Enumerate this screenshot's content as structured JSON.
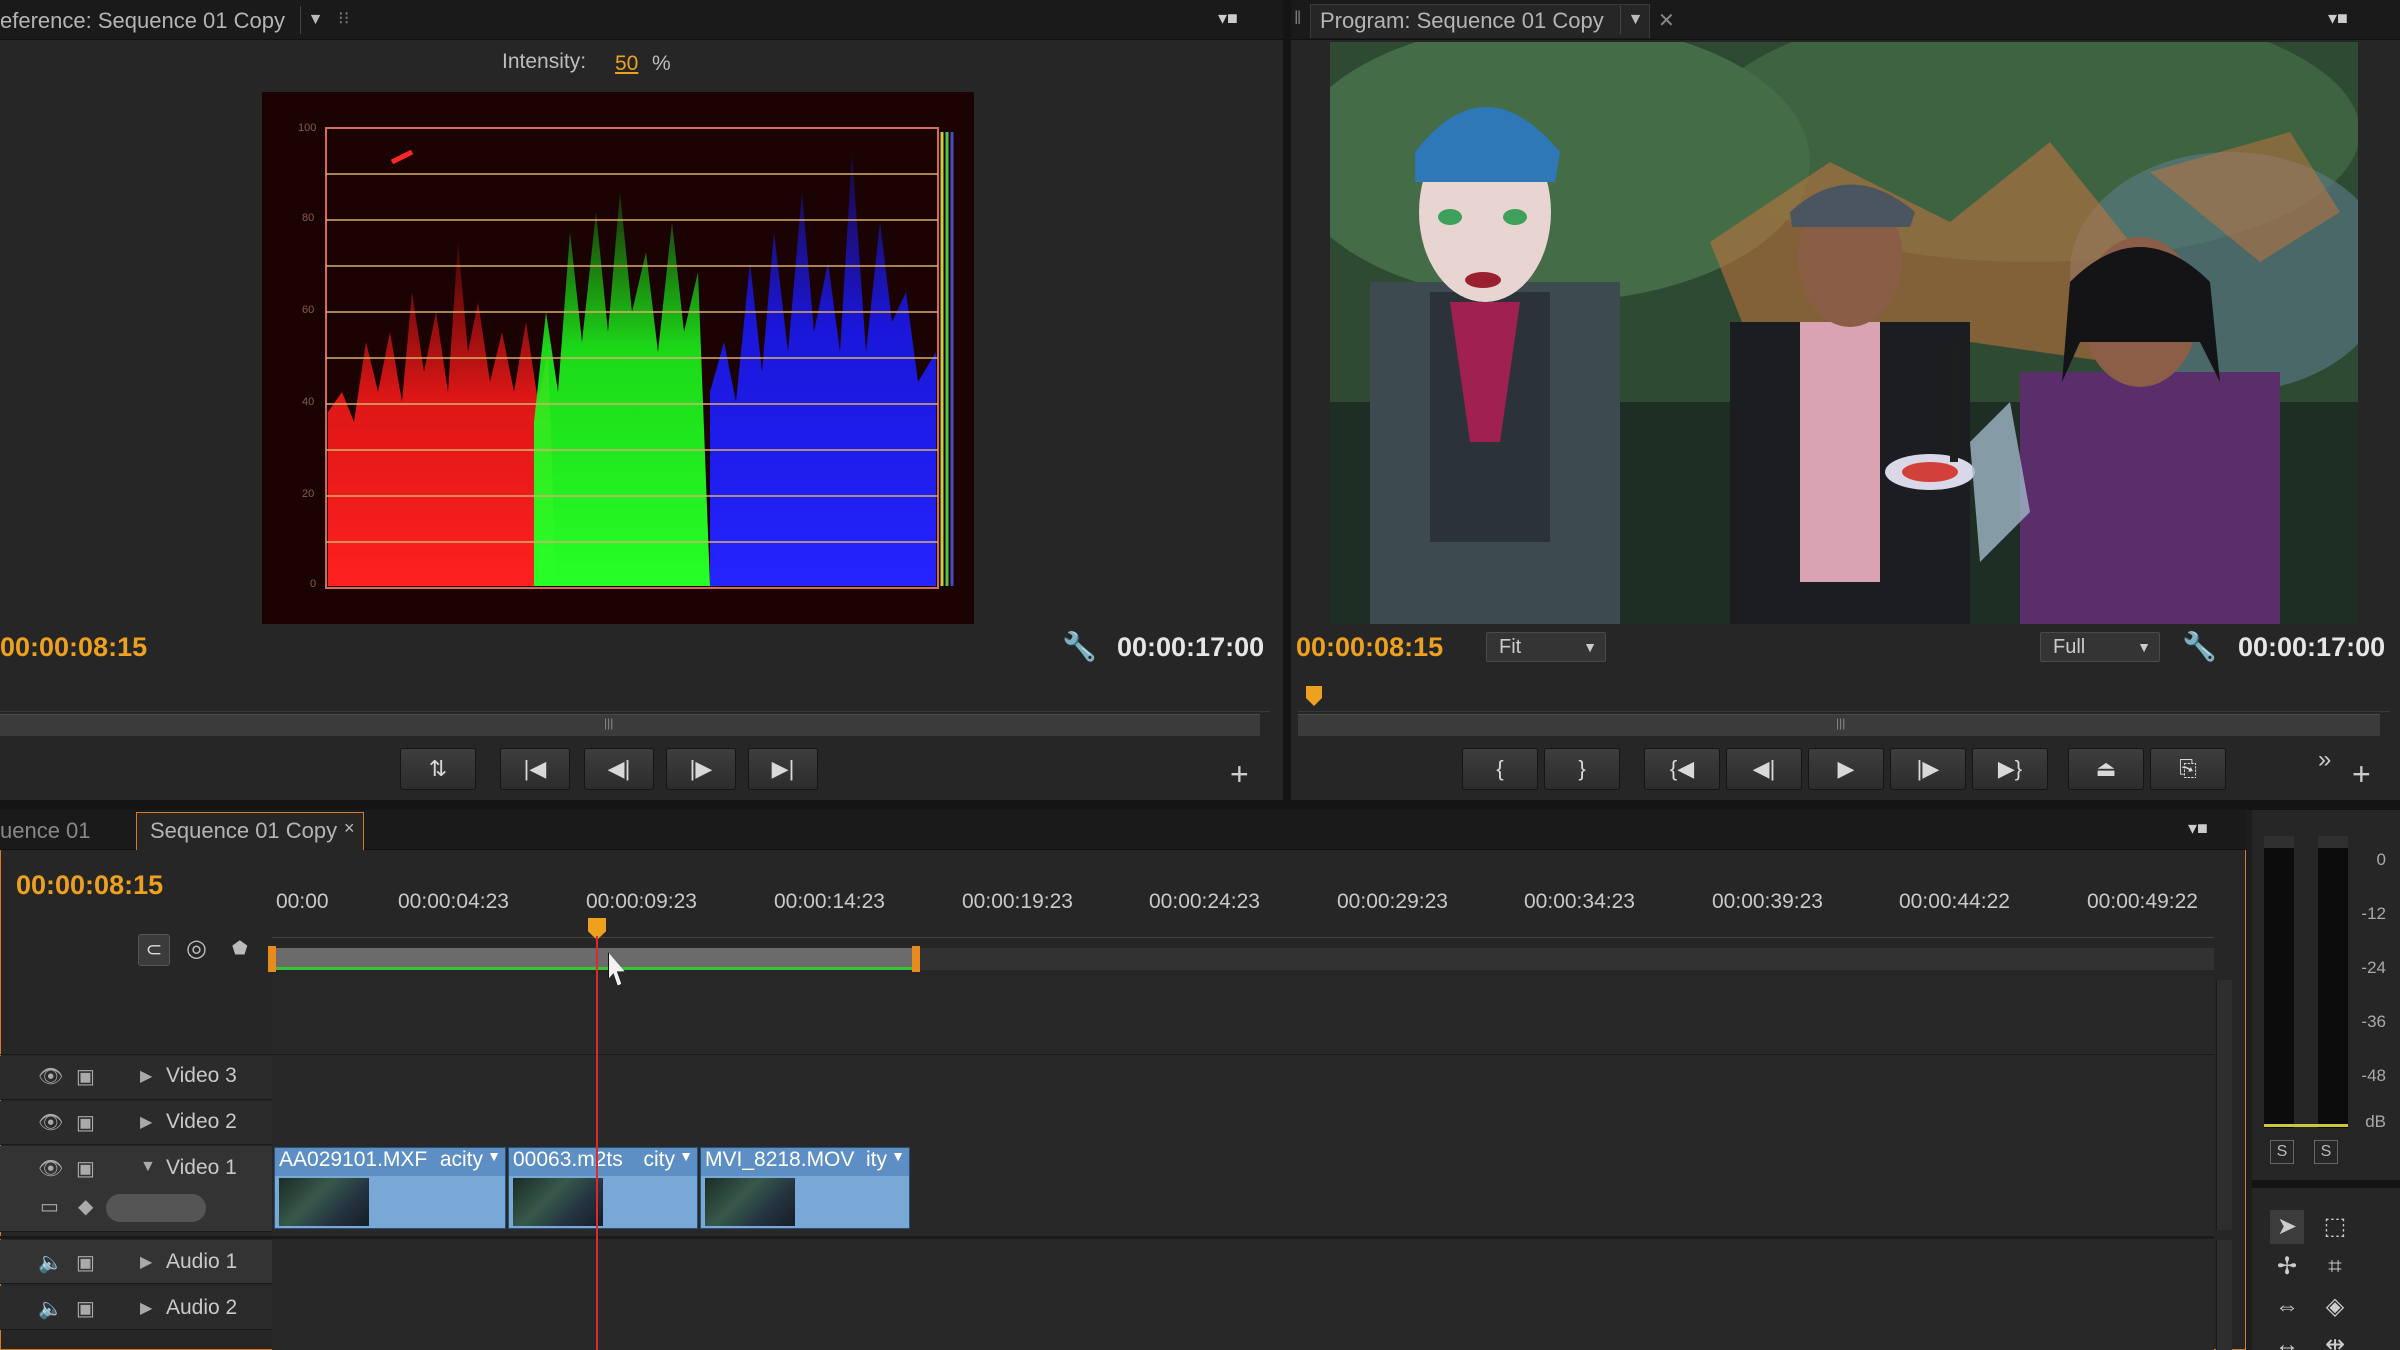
{
  "reference_monitor": {
    "tab_title": "eference: Sequence 01 Copy",
    "intensity_label": "Intensity:",
    "intensity_value": "50",
    "intensity_unit": "%",
    "scope_scale": [
      "100",
      "80",
      "60",
      "40",
      "20",
      "0"
    ],
    "timecode_current": "00:00:08:15",
    "timecode_duration": "00:00:17:00"
  },
  "program_monitor": {
    "tab_title": "Program: Sequence 01 Copy",
    "timecode_current": "00:00:08:15",
    "timecode_duration": "00:00:17:00",
    "zoom_select": "Fit",
    "quality_select": "Full"
  },
  "timeline": {
    "tabs": [
      {
        "label": "uence 01"
      },
      {
        "label": "Sequence 01 Copy"
      }
    ],
    "current_timecode": "00:00:08:15",
    "ruler": [
      "00:00",
      "00:00:04:23",
      "00:00:09:23",
      "00:00:14:23",
      "00:00:19:23",
      "00:00:24:23",
      "00:00:29:23",
      "00:00:34:23",
      "00:00:39:23",
      "00:00:44:22",
      "00:00:49:22"
    ],
    "tracks": {
      "video3": "Video 3",
      "video2": "Video 2",
      "video1": "Video 1",
      "audio1": "Audio 1",
      "audio2": "Audio 2"
    },
    "clips": [
      {
        "name": "AA029101.MXF",
        "effect": "acity"
      },
      {
        "name": "00063.m2ts",
        "effect": "city"
      },
      {
        "name": "MVI_8218.MOV",
        "effect": "ity"
      }
    ]
  },
  "audio_meter": {
    "scale": [
      "0",
      "-12",
      "-24",
      "-36",
      "-48",
      "dB"
    ],
    "solo_left": "S",
    "solo_right": "S"
  },
  "colors": {
    "accent_timecode": "#eda11f",
    "clip_blue": "#7aa8d6",
    "playhead": "#e0272c"
  }
}
